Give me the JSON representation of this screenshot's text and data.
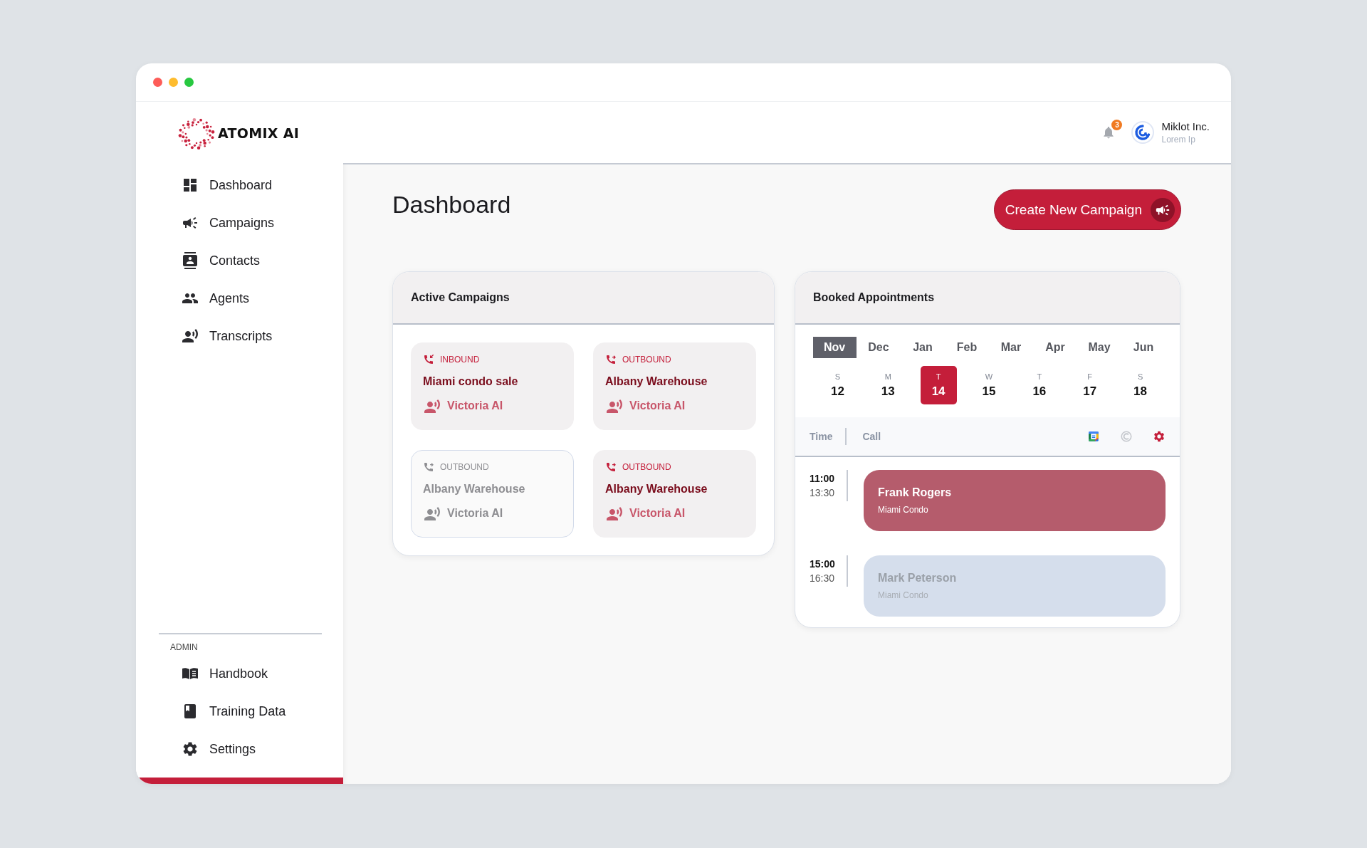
{
  "sidebar": {
    "brand": "ATOMIX AI",
    "nav": [
      {
        "label": "Dashboard"
      },
      {
        "label": "Campaigns"
      },
      {
        "label": "Contacts"
      },
      {
        "label": "Agents"
      },
      {
        "label": "Transcripts"
      }
    ],
    "admin_heading": "ADMIN",
    "admin_nav": [
      {
        "label": "Handbook"
      },
      {
        "label": "Training Data"
      },
      {
        "label": "Settings"
      }
    ]
  },
  "header": {
    "notification_count": "3",
    "account_name": "Miklot Inc.",
    "account_subtitle": "Lorem Ip"
  },
  "page_title": "Dashboard",
  "primary_button": "Create New Campaign",
  "active_campaigns": {
    "title": "Active Campaigns",
    "items": [
      {
        "kind": "inbound",
        "direction": "INBOUND",
        "name": "Miami condo sale",
        "agent": "Victoria AI",
        "disabled": false
      },
      {
        "kind": "outbound",
        "direction": "OUTBOUND",
        "name": "Albany Warehouse",
        "agent": "Victoria AI",
        "disabled": false
      },
      {
        "kind": "outbound",
        "direction": "OUTBOUND",
        "name": "Albany Warehouse",
        "agent": "Victoria AI",
        "disabled": true
      },
      {
        "kind": "outbound",
        "direction": "OUTBOUND",
        "name": "Albany Warehouse",
        "agent": "Victoria AI",
        "disabled": false
      }
    ]
  },
  "booked_appointments": {
    "title": "Booked Appointments",
    "months": [
      {
        "label": "Nov",
        "selected": true
      },
      {
        "label": "Dec",
        "selected": false
      },
      {
        "label": "Jan",
        "selected": false
      },
      {
        "label": "Feb",
        "selected": false
      },
      {
        "label": "Mar",
        "selected": false
      },
      {
        "label": "Apr",
        "selected": false
      },
      {
        "label": "May",
        "selected": false
      },
      {
        "label": "Jun",
        "selected": false
      }
    ],
    "days": [
      {
        "weekday": "S",
        "date": "12",
        "selected": false
      },
      {
        "weekday": "M",
        "date": "13",
        "selected": false
      },
      {
        "weekday": "T",
        "date": "14",
        "selected": true
      },
      {
        "weekday": "W",
        "date": "15",
        "selected": false
      },
      {
        "weekday": "T",
        "date": "16",
        "selected": false
      },
      {
        "weekday": "F",
        "date": "17",
        "selected": false
      },
      {
        "weekday": "S",
        "date": "18",
        "selected": false
      }
    ],
    "columns": [
      "Time",
      "Call"
    ],
    "rows": [
      {
        "start": "11:00",
        "end": "13:30",
        "name": "Frank Rogers",
        "subtitle": "Miami Condo",
        "disabled": false
      },
      {
        "start": "15:00",
        "end": "16:30",
        "name": "Mark Peterson",
        "subtitle": "Miami Condo",
        "disabled": true
      }
    ]
  }
}
